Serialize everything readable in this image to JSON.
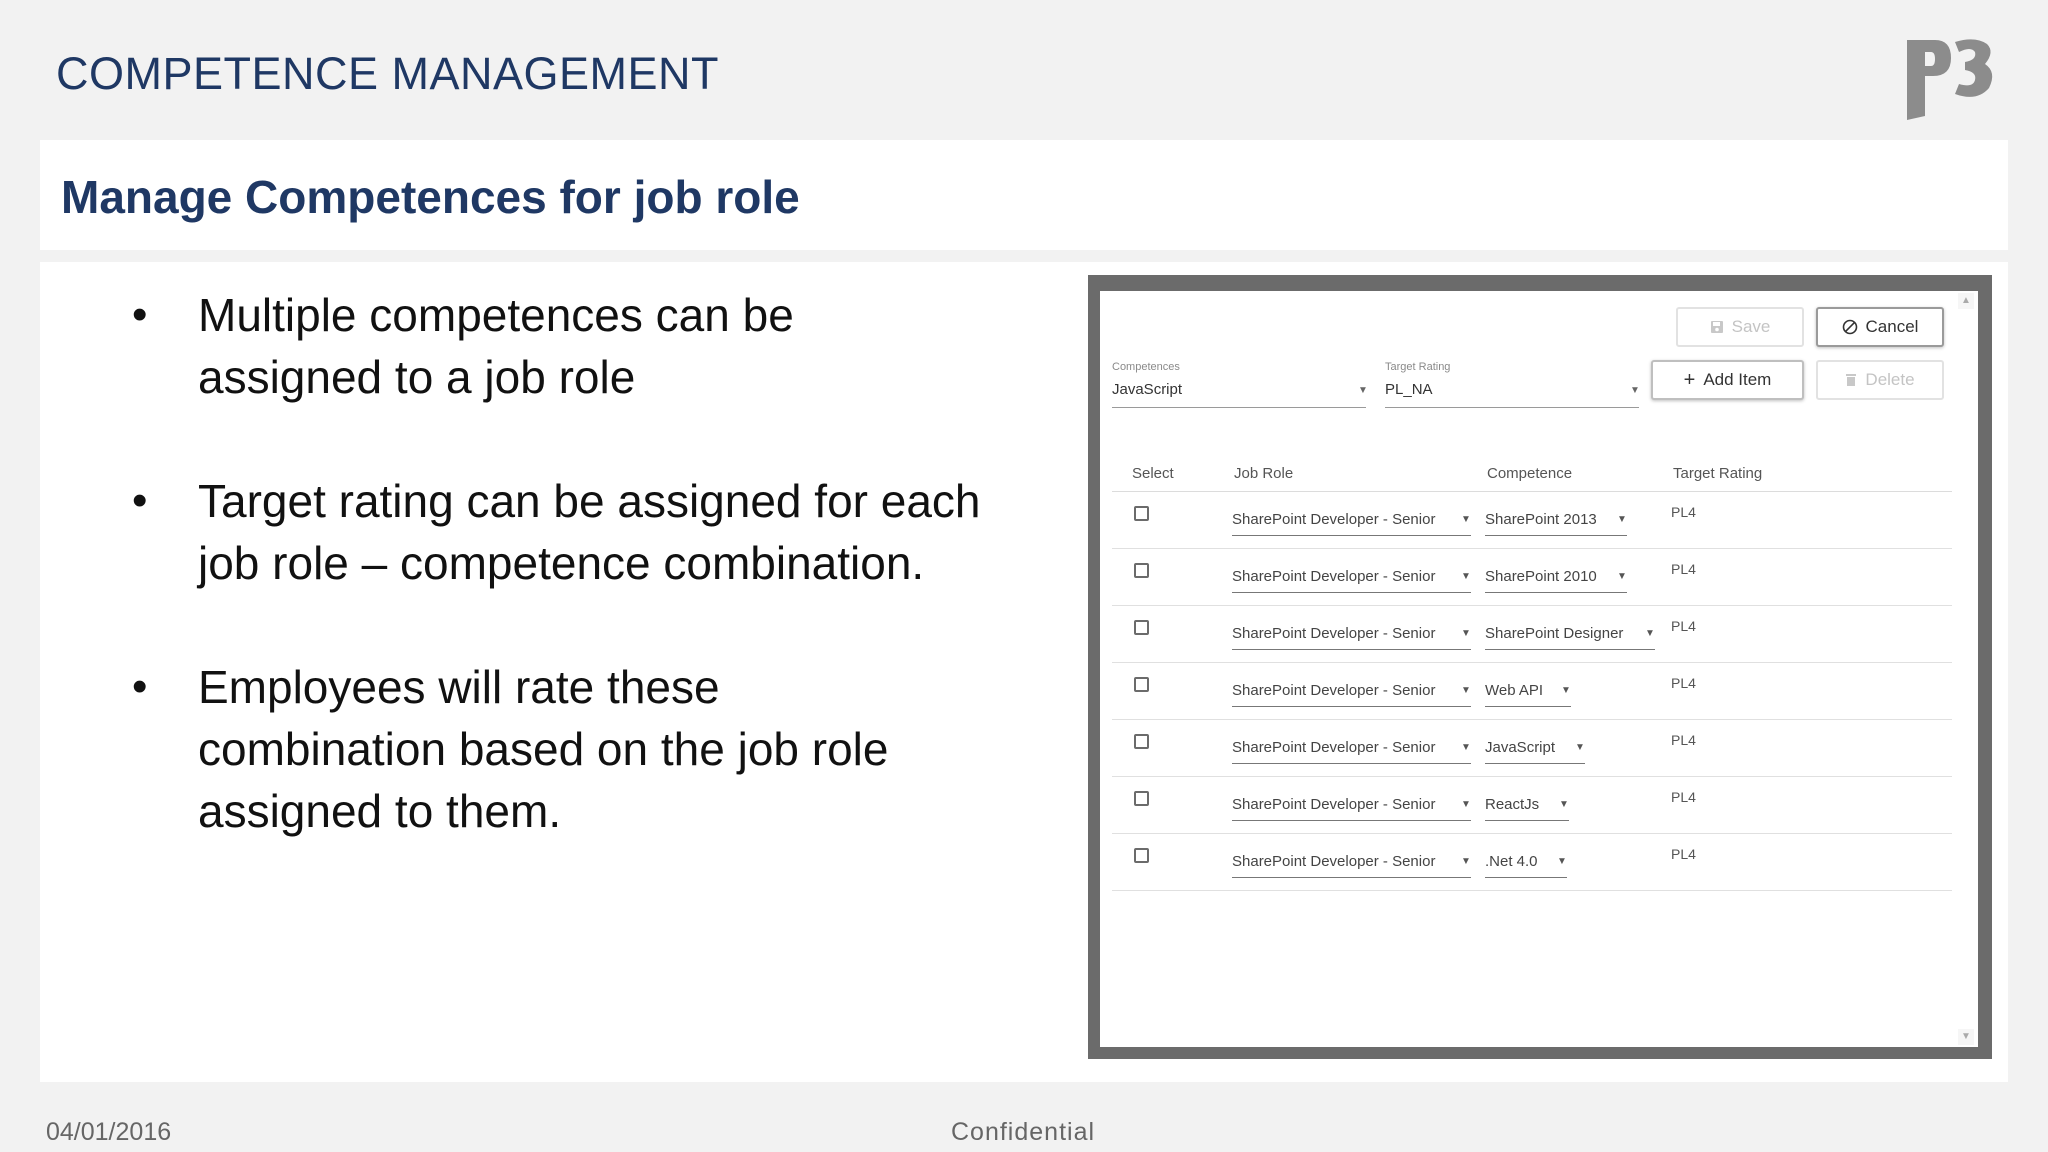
{
  "header": {
    "title": "COMPETENCE MANAGEMENT"
  },
  "section": {
    "title": "Manage Competences for job role"
  },
  "bullets": [
    "Multiple competences can be\nassigned to a job role",
    "Target rating can be assigned for each\njob role – competence combination.",
    "Employees will rate these\ncombination based on the job role\nassigned to them."
  ],
  "app": {
    "buttons": {
      "save": "Save",
      "cancel": "Cancel",
      "add_item": "Add Item",
      "delete": "Delete"
    },
    "filters": {
      "competences_label": "Competences",
      "competences_value": "JavaScript",
      "target_rating_label": "Target Rating",
      "target_rating_value": "PL_NA"
    },
    "table": {
      "headers": [
        "Select",
        "Job Role",
        "Competence",
        "Target Rating"
      ],
      "rows": [
        {
          "job_role": "SharePoint Developer - Senior",
          "competence": "SharePoint 2013",
          "rating": "PL4"
        },
        {
          "job_role": "SharePoint Developer - Senior",
          "competence": "SharePoint 2010",
          "rating": "PL4"
        },
        {
          "job_role": "SharePoint Developer - Senior",
          "competence": "SharePoint Designer",
          "rating": "PL4"
        },
        {
          "job_role": "SharePoint Developer - Senior",
          "competence": "Web API",
          "rating": "PL4"
        },
        {
          "job_role": "SharePoint Developer - Senior",
          "competence": "JavaScript",
          "rating": "PL4"
        },
        {
          "job_role": "SharePoint Developer - Senior",
          "competence": "ReactJs",
          "rating": "PL4"
        },
        {
          "job_role": "SharePoint Developer - Senior",
          "competence": ".Net 4.0",
          "rating": "PL4"
        }
      ]
    }
  },
  "footer": {
    "date": "04/01/2016",
    "confidential": "Confidential"
  },
  "icons": {
    "logo": "p3-logo",
    "save": "floppy-disk-icon",
    "cancel": "circle-slash-icon",
    "add": "plus-icon",
    "delete": "trash-icon",
    "caret": "caret-down-icon"
  },
  "colors": {
    "title": "#1f3864",
    "frame": "#6b6b6b"
  }
}
